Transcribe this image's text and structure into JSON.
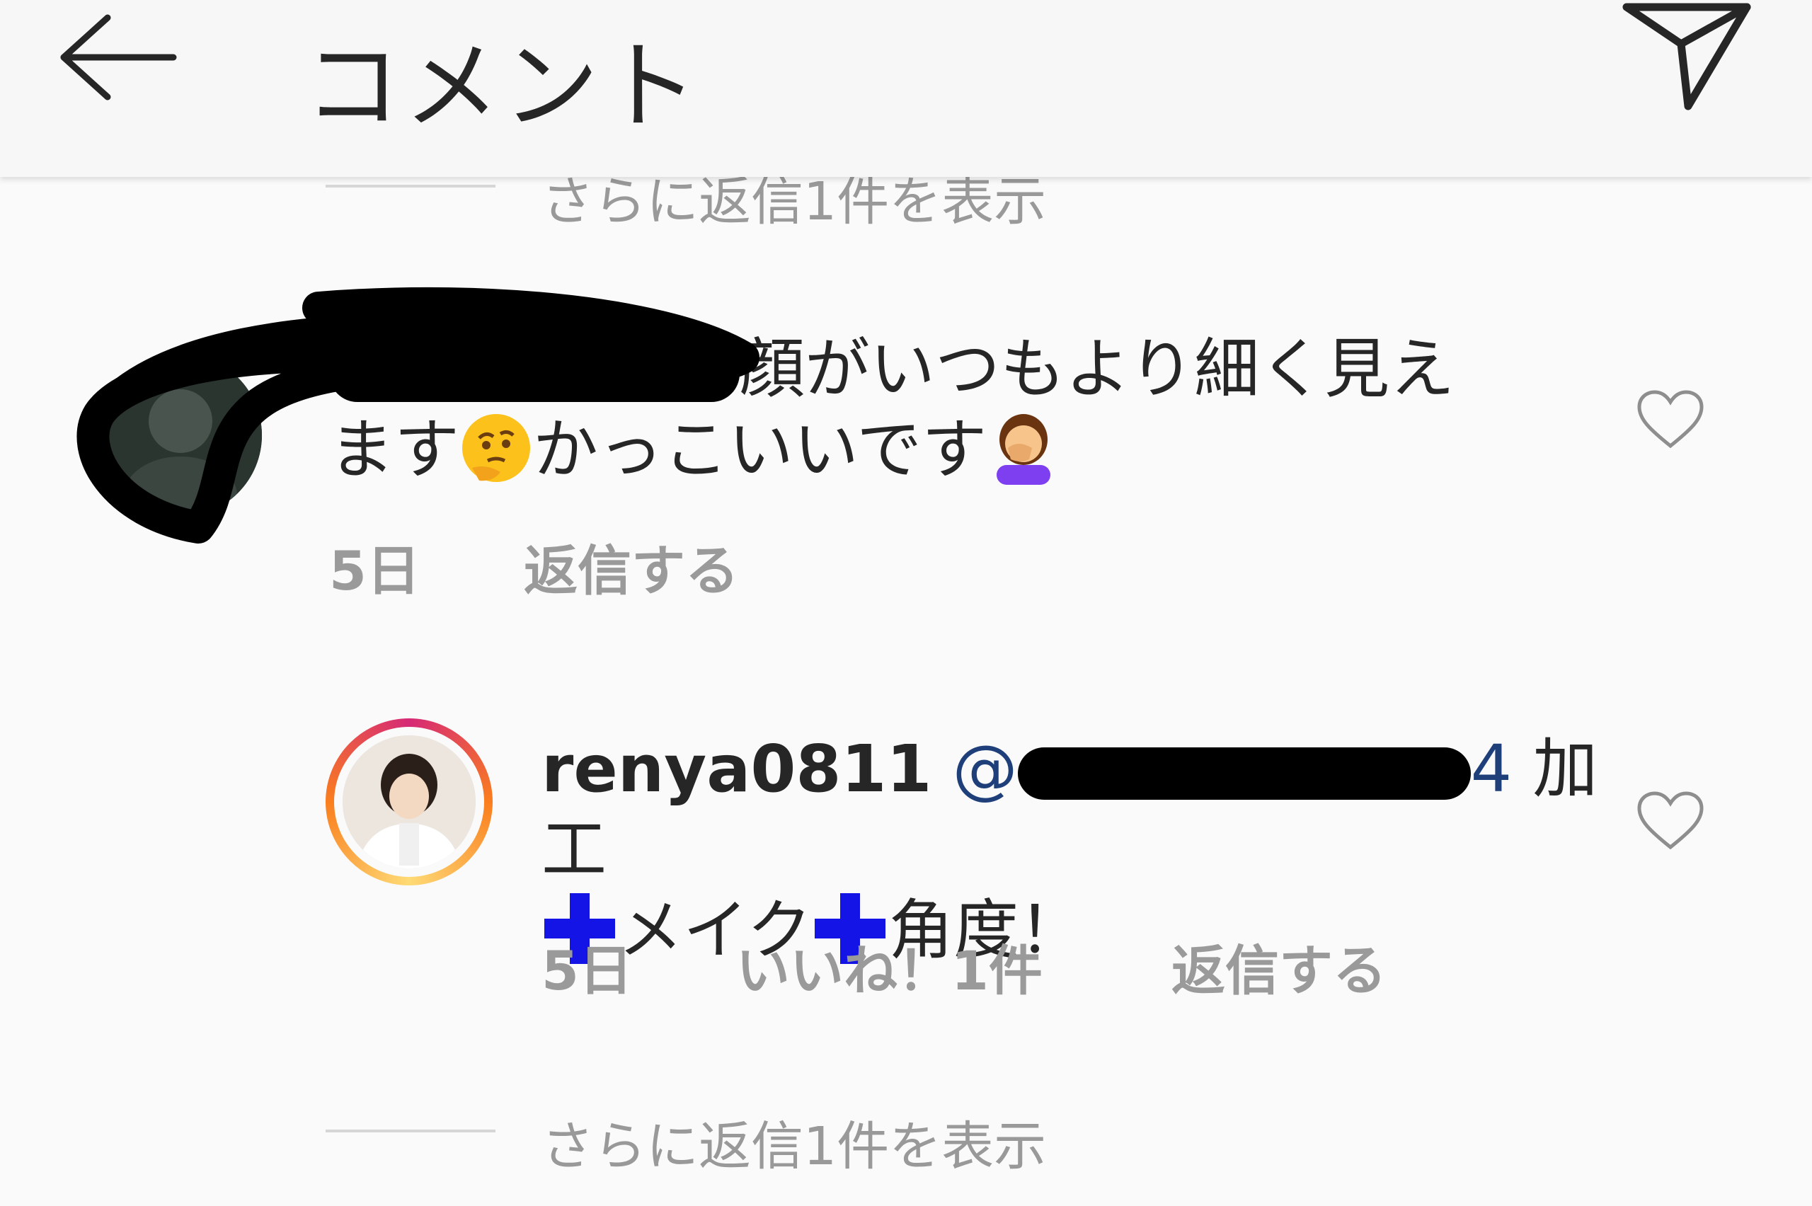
{
  "header": {
    "title": "コメント"
  },
  "top_view_replies": "さらに返信1件を表示",
  "comment1": {
    "text_prefix": "顔がいつもより細く見え",
    "text_line2a": "ます",
    "text_line2b": "かっこいいです",
    "emoji1": "thinking-face",
    "emoji2": "woman-facepalming",
    "time": "5日",
    "reply": "返信する"
  },
  "comment2": {
    "username": "renya0811",
    "mention_prefix": "@",
    "mention_suffix": "4",
    "text_a": "加工",
    "text_b": "メイク",
    "text_c": "角度！",
    "time": "5日",
    "likes": "いいね！1件",
    "reply": "返信する"
  },
  "bottom_view_replies": "さらに返信1件を表示",
  "colors": {
    "background": "#fafafa",
    "text": "#262626",
    "meta": "#9a9a9a",
    "mention": "#1f3f7a",
    "plus": "#1414e6",
    "story_ring": "#d62976"
  }
}
